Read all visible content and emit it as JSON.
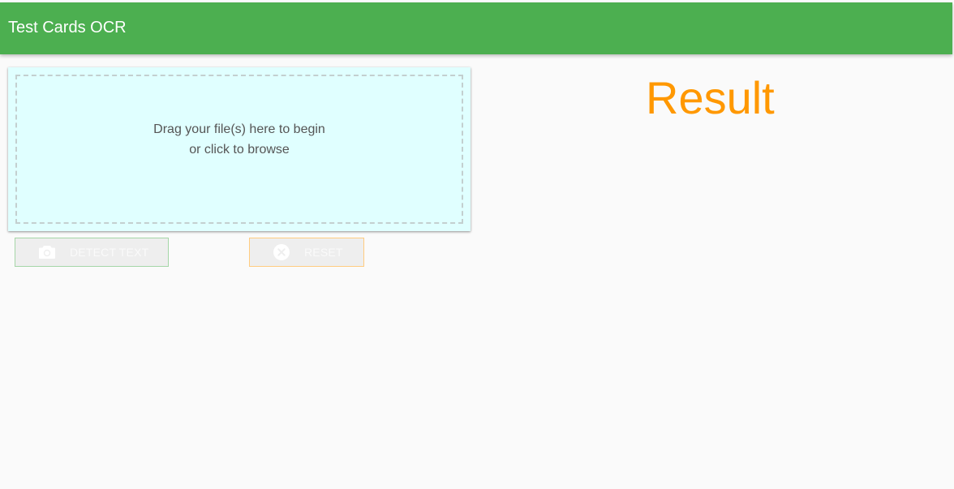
{
  "app": {
    "title": "Test Cards OCR"
  },
  "dropzone": {
    "line1": "Drag your file(s) here to begin",
    "line2": "or click to browse"
  },
  "buttons": {
    "detect": {
      "label": "DETECT TEXT",
      "icon": "camera-icon",
      "color": "#a5d6a7",
      "disabled": true
    },
    "reset": {
      "label": "RESET",
      "icon": "cancel-icon",
      "color": "#ffcc80",
      "disabled": true
    }
  },
  "result": {
    "title": "Result"
  },
  "colors": {
    "header": "#4caf50",
    "dropzone_bg": "#e0ffff",
    "result_title": "#ff9800",
    "background": "#fafafa"
  }
}
